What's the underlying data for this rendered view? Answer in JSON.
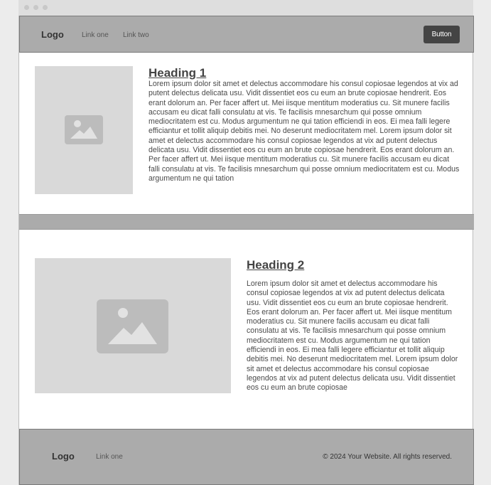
{
  "header": {
    "logo": "Logo",
    "links": [
      "Link one",
      "Link two"
    ],
    "button_label": "Button"
  },
  "section1": {
    "heading": "Heading 1",
    "text": "Lorem ipsum dolor sit amet et delectus accommodare his consul copiosae legendos at vix ad putent delectus delicata usu. Vidit dissentiet eos cu eum an brute copiosae hendrerit. Eos erant dolorum an. Per facer affert ut. Mei iisque mentitum moderatius cu. Sit munere facilis accusam eu dicat falli consulatu at vis. Te facilisis mnesarchum qui posse omnium mediocritatem est cu. Modus argumentum ne qui tation efficiendi in eos. Ei mea falli legere efficiantur et tollit aliquip debitis mei. No deserunt mediocritatem mel. Lorem ipsum dolor sit amet et delectus accommodare his consul copiosae legendos at vix ad putent delectus delicata usu. Vidit dissentiet eos cu eum an brute copiosae hendrerit. Eos erant dolorum an. Per facer affert ut. Mei iisque mentitum moderatius cu. Sit munere facilis accusam eu dicat falli consulatu at vis. Te facilisis mnesarchum qui posse omnium mediocritatem est cu. Modus argumentum ne qui tation",
    "image_icon": "image-placeholder-icon"
  },
  "section2": {
    "heading": "Heading 2",
    "text": "Lorem ipsum dolor sit amet et delectus accommodare his consul copiosae legendos at vix ad putent delectus delicata usu. Vidit dissentiet eos cu eum an brute copiosae hendrerit. Eos erant dolorum an. Per facer affert ut. Mei iisque mentitum moderatius cu. Sit munere facilis accusam eu dicat falli consulatu at vis. Te facilisis mnesarchum qui posse omnium mediocritatem est cu. Modus argumentum ne qui tation efficiendi in eos. Ei mea falli legere efficiantur et tollit aliquip debitis mei. No deserunt mediocritatem mel. Lorem ipsum dolor sit amet et delectus accommodare his consul copiosae legendos at vix ad putent delectus delicata usu. Vidit dissentiet eos cu eum an brute copiosae",
    "image_icon": "image-placeholder-icon"
  },
  "footer": {
    "logo": "Logo",
    "link": "Link one",
    "copyright": "© 2024 Your Website. All rights reserved."
  }
}
